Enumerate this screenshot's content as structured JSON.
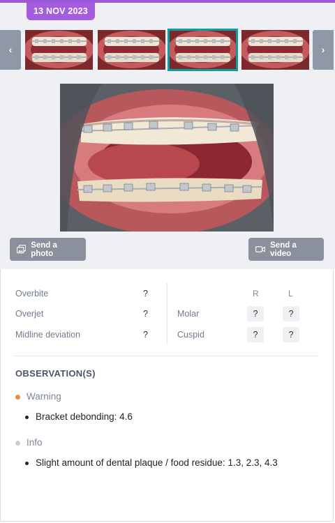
{
  "header": {
    "date": "13 NOV 2023"
  },
  "carousel": {
    "prev_icon": "chevron-left-icon",
    "prev_glyph": "‹",
    "next_icon": "chevron-right-icon",
    "next_glyph": "›",
    "selected_index": 2,
    "thumbnail_count": 4
  },
  "actions": {
    "send_photo": "Send a photo",
    "send_photo_icon": "photos-icon",
    "send_video": "Send a video",
    "send_video_icon": "video-camera-icon"
  },
  "measurements": {
    "left": [
      {
        "label": "Overbite",
        "value": "?"
      },
      {
        "label": "Overjet",
        "value": "?"
      },
      {
        "label": "Midline deviation",
        "value": "?"
      }
    ],
    "right_headers": {
      "r": "R",
      "l": "L"
    },
    "right": [
      {
        "label": "Molar",
        "r": "?",
        "l": "?"
      },
      {
        "label": "Cuspid",
        "r": "?",
        "l": "?"
      }
    ]
  },
  "observations": {
    "title": "OBSERVATION(S)",
    "groups": [
      {
        "level": "Warning",
        "color": "#f0883e",
        "items": [
          "Bracket debonding: 4.6"
        ]
      },
      {
        "level": "Info",
        "color": "#c9cfd8",
        "items": [
          "Slight amount of dental plaque / food residue: 1.3, 2.3, 4.3"
        ]
      }
    ]
  },
  "colors": {
    "accent_purple": "#a55ddf",
    "selection_teal": "#0b9da2",
    "button_gray": "#8a919d"
  }
}
